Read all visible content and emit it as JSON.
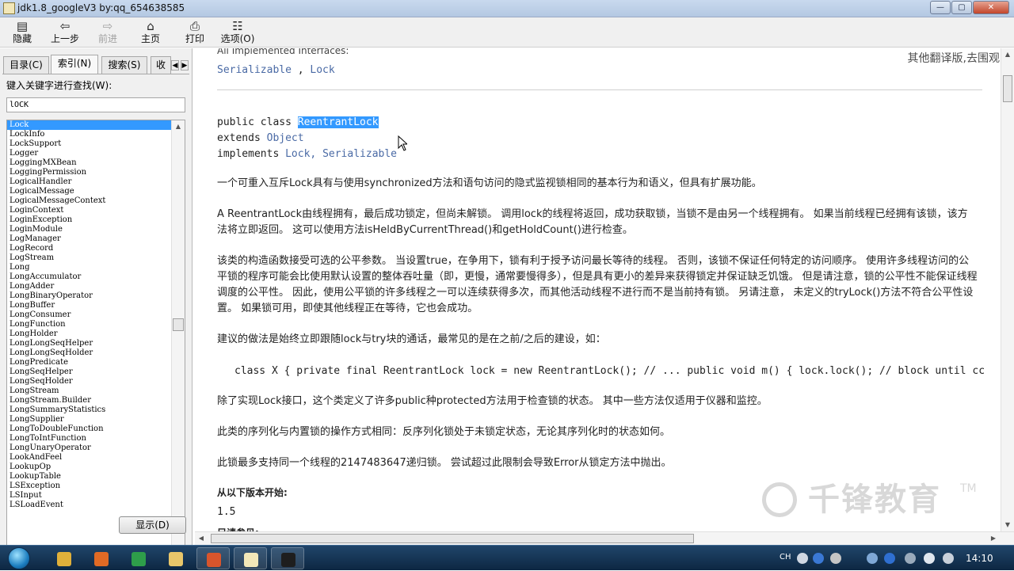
{
  "window": {
    "title": "jdk1.8_googleV3 by:qq_654638585",
    "controls": {
      "minimize": "0",
      "maximize": "1",
      "close": "r"
    }
  },
  "toolbar": {
    "items": [
      {
        "label": "隐藏",
        "icon": "hide-icon",
        "glyph": "▤"
      },
      {
        "label": "上一步",
        "icon": "back-arrow-icon",
        "glyph": "⇦"
      },
      {
        "label": "前进",
        "icon": "forward-arrow-icon",
        "glyph": "⇨"
      },
      {
        "label": "主页",
        "icon": "home-icon",
        "glyph": "⌂"
      },
      {
        "label": "打印",
        "icon": "printer-icon",
        "glyph": "⎙"
      },
      {
        "label": "选项(O)",
        "icon": "options-icon",
        "glyph": "☷"
      }
    ]
  },
  "nav": {
    "tabs": [
      {
        "label": "目录(C)"
      },
      {
        "label": "索引(N)"
      },
      {
        "label": "搜索(S)"
      },
      {
        "label": "收"
      }
    ],
    "tab_scroll": {
      "left": "◀",
      "right": "▶"
    },
    "keyword_label": "键入关键字进行查找(W):",
    "keyword_value": "lOCK",
    "selected_index": 0,
    "list": [
      "Lock",
      "LockInfo",
      "LockSupport",
      "Logger",
      "LoggingMXBean",
      "LoggingPermission",
      "LogicalHandler",
      "LogicalMessage",
      "LogicalMessageContext",
      "LoginContext",
      "LoginException",
      "LoginModule",
      "LogManager",
      "LogRecord",
      "LogStream",
      "Long",
      "LongAccumulator",
      "LongAdder",
      "LongBinaryOperator",
      "LongBuffer",
      "LongConsumer",
      "LongFunction",
      "LongHolder",
      "LongLongSeqHelper",
      "LongLongSeqHolder",
      "LongPredicate",
      "LongSeqHelper",
      "LongSeqHolder",
      "LongStream",
      "LongStream.Builder",
      "LongSummaryStatistics",
      "LongSupplier",
      "LongToDoubleFunction",
      "LongToIntFunction",
      "LongUnaryOperator",
      "LookAndFeel",
      "LookupOp",
      "LookupTable",
      "LSException",
      "LSInput",
      "LSLoadEvent"
    ],
    "show_button": "显示(D)"
  },
  "content": {
    "top_note": "其他翻译版,去围观",
    "impl_header_partial": "All Implemented Interfaces:",
    "impl_list": [
      "Serializable",
      "Lock"
    ],
    "decl_public": "public class",
    "decl_class": "ReentrantLock",
    "decl_extends": "extends",
    "decl_super": "Object",
    "decl_implements": "implements",
    "decl_iface1": "Lock,",
    "decl_iface2": "Serializable",
    "p1": "一个可重入互斥Lock具有与使用synchronized方法和语句访问的隐式监视锁相同的基本行为和语义，但具有扩展功能。",
    "p2": "A ReentrantLock由线程拥有，最后成功锁定，但尚未解锁。 调用lock的线程将返回，成功获取锁，当锁不是由另一个线程拥有。 如果当前线程已经拥有该锁，该方法将立即返回。 这可以使用方法isHeldByCurrentThread()和getHoldCount()进行检查。",
    "p3": "该类的构造函数接受可选的公平参数。 当设置true，在争用下，锁有利于授予访问最长等待的线程。 否则，该锁不保证任何特定的访问顺序。 使用许多线程访问的公平锁的程序可能会比使用默认设置的整体吞吐量（即，更慢，通常要慢得多），但是具有更小的差异来获得锁定并保证缺乏饥饿。 但是请注意，锁的公平性不能保证线程调度的公平性。 因此，使用公平锁的许多线程之一可以连续获得多次，而其他活动线程不进行而不是当前持有锁。 另请注意， 未定义的tryLock()方法不符合公平性设置。 如果锁可用，即使其他线程正在等待，它也会成功。",
    "p4": "建议的做法是始终立即跟随lock与try块的通话，最常见的是在之前/之后的建设，如：",
    "code": "class X { private final ReentrantLock lock = new ReentrantLock(); // ... public void m() { lock.lock(); // block until cc",
    "p5": "除了实现Lock接口，这个类定义了许多public种protected方法用于检查锁的状态。 其中一些方法仅适用于仪器和监控。",
    "p6": "此类的序列化与内置锁的操作方式相同：反序列化锁处于未锁定状态，无论其序列化时的状态如何。",
    "p7": "此锁最多支持同一个线程的2147483647递归锁。 尝试超过此限制会导致Error从锁定方法中抛出。",
    "since_label": "从以下版本开始:",
    "since_value": "1.5",
    "seealso_partial": "另请参见:",
    "watermark": "千锋教育",
    "watermark_tm": "TM"
  },
  "taskbar": {
    "apps": [
      {
        "icon": "chrome-icon",
        "color": "#e0b03a"
      },
      {
        "icon": "firefox-icon",
        "color": "#e06a25"
      },
      {
        "icon": "code-editor-icon",
        "color": "#2e9e4a"
      },
      {
        "icon": "file-explorer-icon",
        "color": "#e8c66a"
      },
      {
        "icon": "presentation-icon",
        "color": "#d9552c"
      },
      {
        "icon": "help-viewer-icon",
        "color": "#f2e7b8"
      },
      {
        "icon": "ide-icon",
        "color": "#1e1e1e"
      }
    ],
    "lang": "CH",
    "clock": "14:10"
  }
}
